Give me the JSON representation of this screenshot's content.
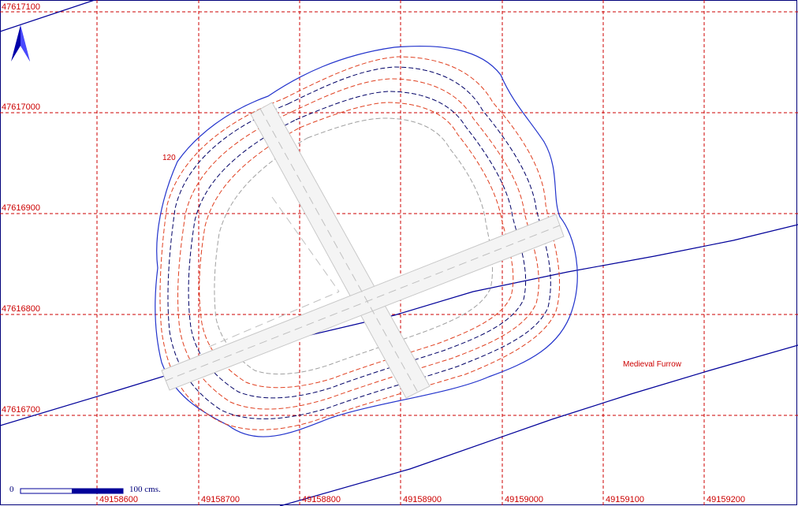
{
  "map": {
    "x_grid_labels": [
      "49158600",
      "49158700",
      "49158800",
      "49158900",
      "49159000",
      "49159100",
      "49159200"
    ],
    "y_grid_labels": [
      "47617100",
      "47617000",
      "47616900",
      "47616800",
      "47616700"
    ],
    "annotations": {
      "contour_label": "120",
      "furrow_label": "Medieval Furrow"
    },
    "scale_bar": {
      "start_label": "0",
      "end_label": "100 cms."
    },
    "north_arrow": "north-arrow-icon",
    "colors": {
      "grid": "#cc0000",
      "outline": "#2233cc",
      "dashed_red": "#e04020",
      "dashed_blue": "#000066",
      "trench": "#c8c8c8",
      "furrow": "#000099"
    }
  }
}
